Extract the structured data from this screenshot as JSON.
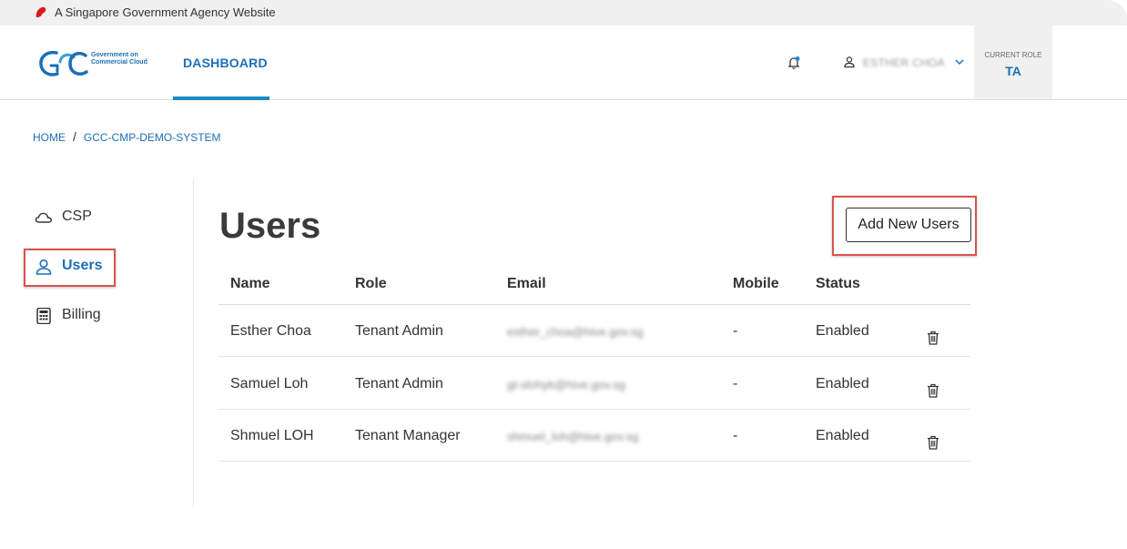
{
  "masthead": {
    "text": "A Singapore Government Agency Website",
    "icon": "singapore-lion-icon"
  },
  "header": {
    "logo_lines": [
      "Government on",
      "Commercial Cloud"
    ],
    "nav_dashboard": "DASHBOARD",
    "user_name": "ESTHER CHOA",
    "role_label": "CURRENT ROLE",
    "role_value": "TA"
  },
  "breadcrumb": {
    "home": "HOME",
    "separator": "/",
    "current": "GCC-CMP-DEMO-SYSTEM"
  },
  "sidebar": {
    "items": [
      {
        "label": "CSP",
        "icon": "cloud-icon"
      },
      {
        "label": "Users",
        "icon": "person-icon"
      },
      {
        "label": "Billing",
        "icon": "calculator-icon"
      }
    ]
  },
  "main": {
    "title": "Users",
    "add_button": "Add New Users",
    "columns": [
      "Name",
      "Role",
      "Email",
      "Mobile",
      "Status"
    ],
    "rows": [
      {
        "name": "Esther Choa",
        "role": "Tenant Admin",
        "email": "esther_choa@hive.gov.sg",
        "mobile": "-",
        "status": "Enabled"
      },
      {
        "name": "Samuel Loh",
        "role": "Tenant Admin",
        "email": "gt-slohyk@hive.gov.sg",
        "mobile": "-",
        "status": "Enabled"
      },
      {
        "name": "Shmuel LOH",
        "role": "Tenant Manager",
        "email": "shmuel_loh@hive.gov.sg",
        "mobile": "-",
        "status": "Enabled"
      }
    ]
  },
  "colors": {
    "accent": "#1d6fb8",
    "highlight": "#d9534f",
    "lion": "#d71920"
  }
}
